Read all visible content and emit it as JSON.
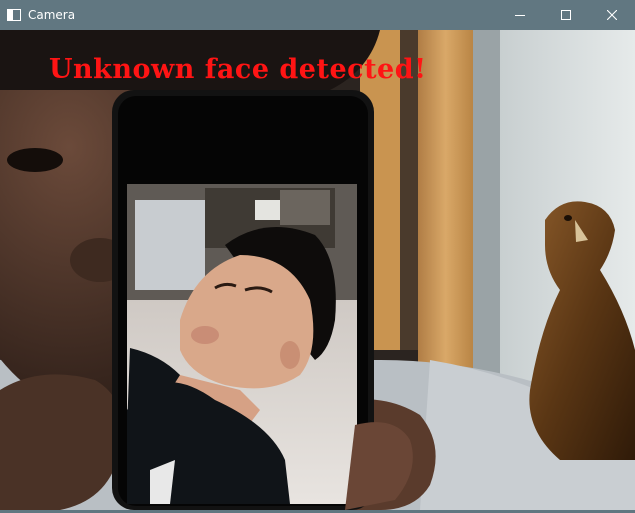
{
  "window": {
    "title": "Camera",
    "icon": "camera-window-icon",
    "controls": [
      "minimize-icon",
      "maximize-icon",
      "close-icon"
    ]
  },
  "camera_feed": {
    "overlay_text": "Unknown face detected!",
    "overlay_color": "#ff1414"
  },
  "colors": {
    "titlebar": "#617781",
    "titlebar_text": "#ffffff"
  }
}
